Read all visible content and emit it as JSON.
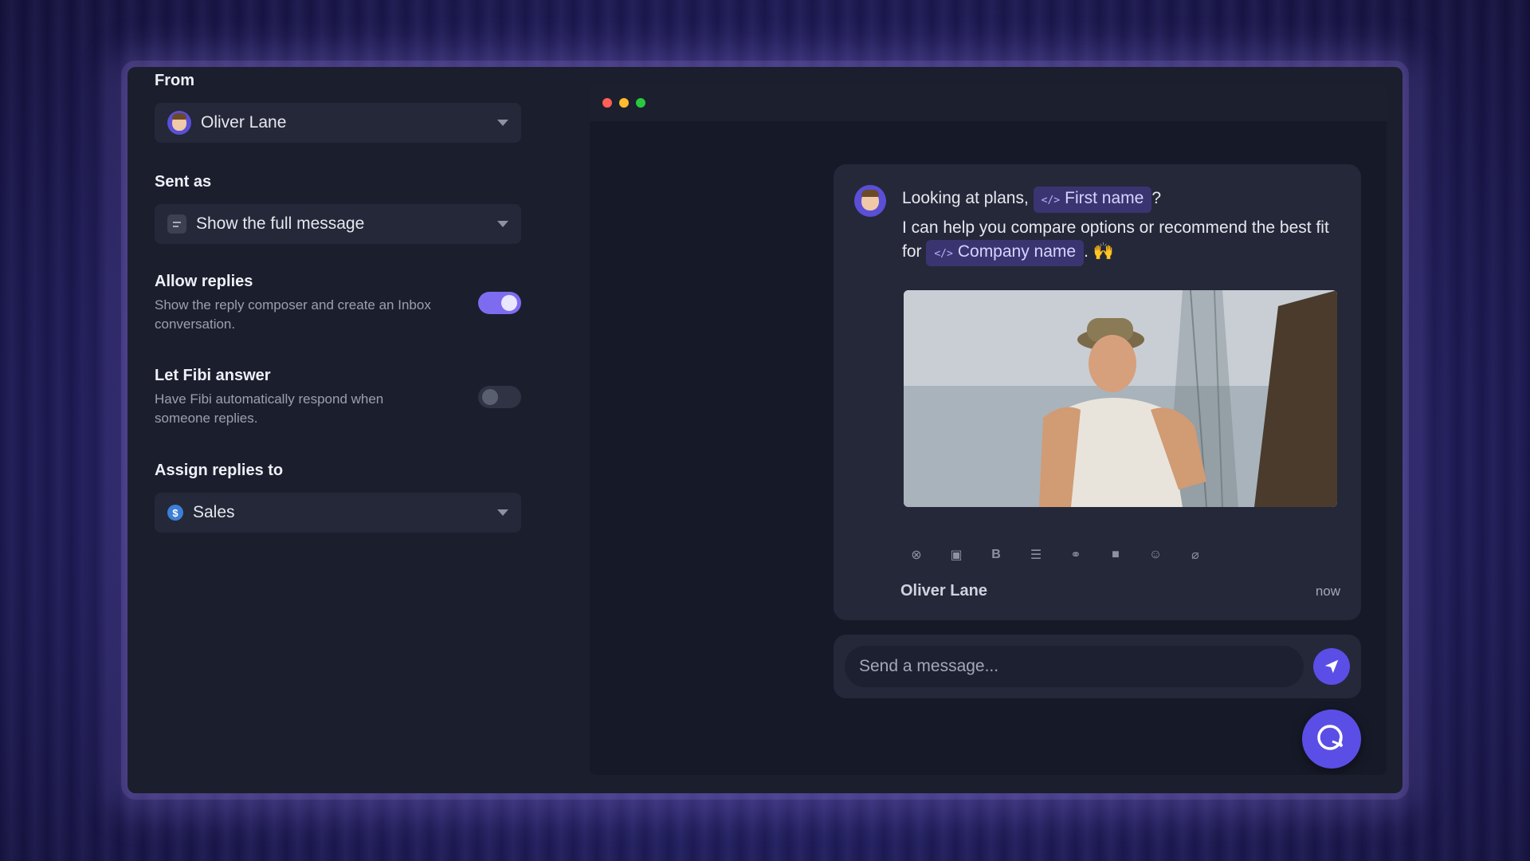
{
  "theme": {
    "accent": "#5b4ee6",
    "toggle_on": "#7e6cf0",
    "chip_bg": "#3a3570"
  },
  "settings": {
    "from": {
      "label": "From",
      "value": "Oliver Lane",
      "icon": "avatar-icon"
    },
    "sent_as": {
      "label": "Sent as",
      "value": "Show the full message",
      "icon": "document-icon"
    },
    "allow_replies": {
      "label": "Allow replies",
      "description": "Show the reply composer and create an Inbox conversation.",
      "enabled": true
    },
    "let_fibi": {
      "label": "Let Fibi answer",
      "description": "Have Fibi automatically respond when someone replies.",
      "enabled": false
    },
    "assign_to": {
      "label": "Assign replies to",
      "value": "Sales",
      "icon": "dollar-icon"
    }
  },
  "preview": {
    "message": {
      "line1_prefix": "Looking at plans,",
      "chip1": "First name",
      "line1_suffix": "?",
      "line2_prefix": "I can help you compare options or recommend the best fit for",
      "chip2": "Company name",
      "line2_suffix": ".",
      "emoji": "🙌"
    },
    "image": {
      "icon": "gif-image"
    },
    "toolbar_icons": [
      "close-circle-icon",
      "image-icon",
      "bold-icon",
      "list-icon",
      "link-icon",
      "video-icon",
      "emoji-icon",
      "attachment-icon"
    ],
    "sender": "Oliver Lane",
    "time": "now",
    "composer_placeholder": "Send a message..."
  }
}
